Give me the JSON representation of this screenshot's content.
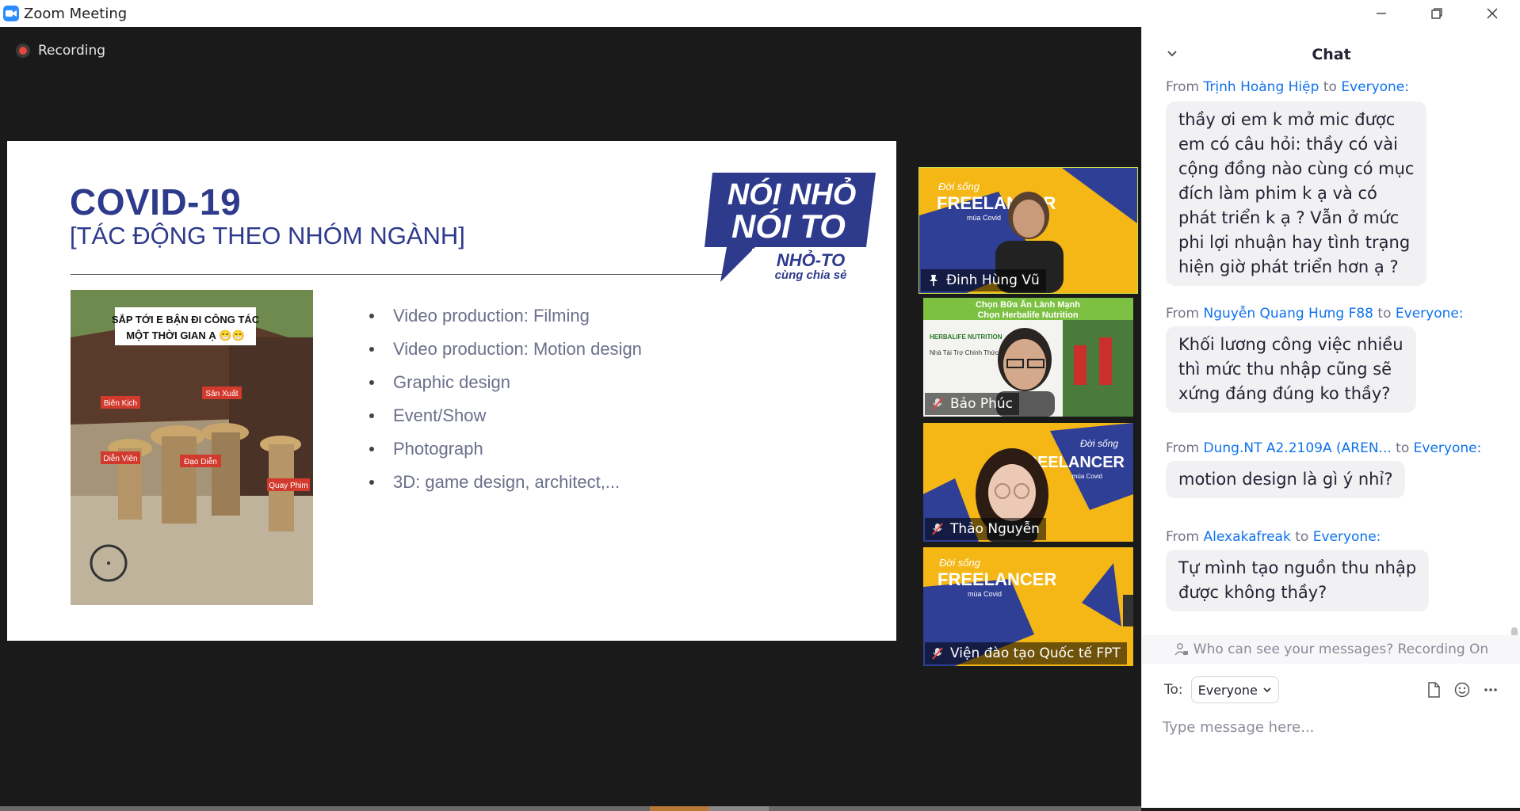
{
  "window": {
    "title": "Zoom Meeting",
    "icon": "zoom-camera-icon",
    "controls": [
      "minimize-icon",
      "restore-icon",
      "close-icon"
    ]
  },
  "meeting": {
    "recording_label": "Recording",
    "recording_color": "#e8453c"
  },
  "slide": {
    "title": "COVID-19",
    "subtitle": "[TÁC ĐỘNG THEO NHÓM NGÀNH]",
    "logo": {
      "line1": "NÓI NHỎ",
      "line2": "NÓI TO",
      "line3": "NHỎ-TO",
      "line4": "cùng chia sẻ"
    },
    "photo": {
      "caption_line1": "SẮP TỚI E BẬN ĐI CÔNG TÁC",
      "caption_line2": "MỘT THỜI GIAN Ạ 😁😁",
      "tags": [
        "Biên Kịch",
        "Sản Xuất",
        "Diễn Viên",
        "Đạo Diễn",
        "Quay Phim"
      ]
    },
    "bullets": [
      "Video production: Filming",
      "Video production: Motion design",
      "Graphic design",
      "Event/Show",
      "Photograph",
      "3D: game design, architect,..."
    ]
  },
  "participants": [
    {
      "name": "Đinh Hùng Vũ",
      "icon": "pin-icon",
      "active": true,
      "bg_line1": "Đời sống",
      "bg_line2": "FREELANCER",
      "bg_line3": "mùa Covid"
    },
    {
      "name": "Bảo Phúc",
      "icon": "mic-muted-icon",
      "active": false,
      "bg_line1": "Chọn Bữa Ăn Lành Mạnh",
      "bg_line2": "Chọn Herbalife Nutrition",
      "bg_line3": "HERBALIFE NUTRITION",
      "bg_line4": "Nhà Tài Trợ Chính Thức"
    },
    {
      "name": "Thảo Nguyễn",
      "icon": "mic-muted-icon",
      "active": false,
      "bg_line1": "Đời sống",
      "bg_line2": "FREELANCER",
      "bg_line3": "mùa Covid"
    },
    {
      "name": "Viện đào tạo Quốc tế FPT",
      "icon": "mic-muted-icon",
      "active": false,
      "bg_line1": "Đời sống",
      "bg_line2": "FREELANCER",
      "bg_line3": "mùa Covid"
    }
  ],
  "chat": {
    "title": "Chat",
    "from_word": "From",
    "to_word": "to",
    "messages": [
      {
        "from": "Trịnh Hoàng Hiệp",
        "to": "Everyone:",
        "lines": [
          "thầy ơi em k mở mic được",
          "em có câu hỏi: thầy có vài",
          "cộng đồng nào cùng có mục",
          "đích  làm phim k ạ và có",
          "phát triển k ạ ? Vẫn ở mức",
          "phi lợi nhuận hay tình trạng",
          "hiện giờ phát triển hơn ạ ?"
        ]
      },
      {
        "from": "Nguyễn Quang Hưng F88",
        "to": "Everyone:",
        "lines": [
          "Khối lương công việc nhiều",
          "thì mức thu nhập cũng sẽ",
          "xứng đáng đúng ko thầy?"
        ]
      },
      {
        "from": "Dung.NT A2.2109A (AREN...",
        "to": "Everyone:",
        "lines": [
          "motion design là gì ý nhỉ?"
        ]
      },
      {
        "from": "Alexakafreak",
        "to": "Everyone:",
        "lines": [
          "Tự mình tạo nguồn thu nhập",
          "được không thầy?"
        ]
      }
    ],
    "privacy_notice": "Who can see your messages? Recording On",
    "to_label": "To:",
    "recipient": "Everyone",
    "input_placeholder": "Type message here...",
    "tools": [
      "file-icon",
      "emoji-icon",
      "more-icon"
    ]
  },
  "colors": {
    "accent_blue": "#0e72ed",
    "slide_navy": "#2e3a8c",
    "tile_yellow": "#f4b716",
    "active_border": "#c7e04a"
  }
}
